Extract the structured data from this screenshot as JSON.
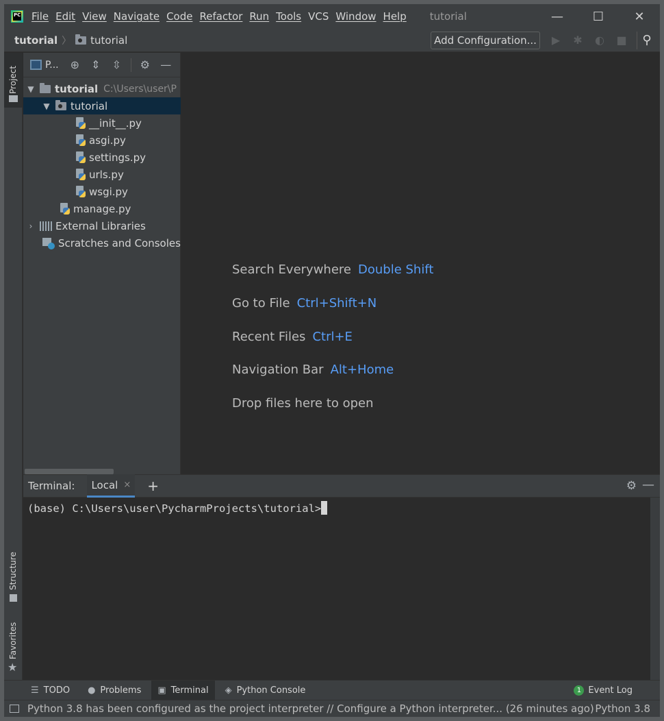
{
  "titlebar": {
    "logo_text": "PC",
    "menu": [
      "File",
      "Edit",
      "View",
      "Navigate",
      "Code",
      "Refactor",
      "Run",
      "Tools",
      "VCS",
      "Window",
      "Help"
    ],
    "window_title": "tutorial",
    "minimize": "—",
    "maximize": "☐",
    "close": "✕"
  },
  "navbar": {
    "project": "tutorial",
    "separator": "〉",
    "folder": "tutorial",
    "add_configuration": "Add Configuration..."
  },
  "left_strip": {
    "project_tab": "Project",
    "structure_tab": "Structure",
    "favorites_tab": "Favorites"
  },
  "project_panel": {
    "view_selector": "P...",
    "tree": [
      {
        "label": "tutorial",
        "path": "C:\\Users\\user\\P",
        "bold": true
      },
      {
        "label": "tutorial"
      },
      {
        "label": "__init__.py"
      },
      {
        "label": "asgi.py"
      },
      {
        "label": "settings.py"
      },
      {
        "label": "urls.py"
      },
      {
        "label": "wsgi.py"
      },
      {
        "label": "manage.py"
      },
      {
        "label": "External Libraries"
      },
      {
        "label": "Scratches and Consoles"
      }
    ]
  },
  "editor": {
    "hints": [
      {
        "text": "Search Everywhere",
        "key": "Double Shift"
      },
      {
        "text": "Go to File",
        "key": "Ctrl+Shift+N"
      },
      {
        "text": "Recent Files",
        "key": "Ctrl+E"
      },
      {
        "text": "Navigation Bar",
        "key": "Alt+Home"
      },
      {
        "text": "Drop files here to open",
        "key": ""
      }
    ]
  },
  "terminal": {
    "title": "Terminal:",
    "tab": "Local",
    "tab_close": "×",
    "add": "+",
    "prompt": "(base) C:\\Users\\user\\PycharmProjects\\tutorial>"
  },
  "bottom_tabs": {
    "todo": "TODO",
    "problems": "Problems",
    "terminal": "Terminal",
    "python_console": "Python Console",
    "event_log_count": "1",
    "event_log": "Event Log"
  },
  "statusbar": {
    "message": "Python 3.8 has been configured as the project interpreter // Configure a Python interpreter... (26 minutes ago)",
    "interpreter": "Python 3.8"
  },
  "colors": {
    "background": "#2b2b2b",
    "panel": "#3c3f41",
    "accent": "#589df6",
    "selection": "#0d293e"
  }
}
